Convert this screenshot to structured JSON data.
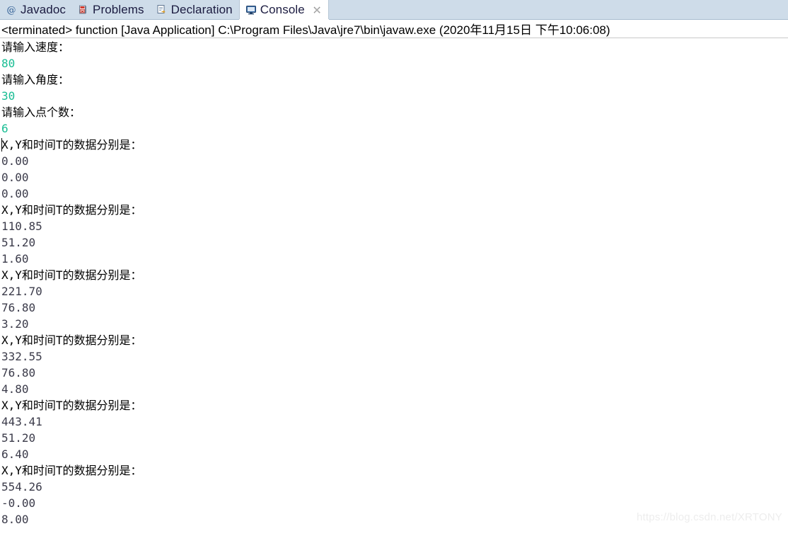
{
  "tabs": [
    {
      "id": "javadoc",
      "label": "Javadoc",
      "icon": "javadoc-at-icon",
      "active": false,
      "closable": false
    },
    {
      "id": "problems",
      "label": "Problems",
      "icon": "problems-error-icon",
      "active": false,
      "closable": false
    },
    {
      "id": "declaration",
      "label": "Declaration",
      "icon": "declaration-doc-icon",
      "active": false,
      "closable": false
    },
    {
      "id": "console",
      "label": "Console",
      "icon": "console-monitor-icon",
      "active": true,
      "closable": true
    }
  ],
  "close_icon": "close-x-icon",
  "process": {
    "status": "<terminated>",
    "launch_name": "function",
    "launch_type": "[Java Application]",
    "executable": "C:\\Program Files\\Java\\jre7\\bin\\javaw.exe",
    "timestamp": "(2020年11月15日 下午10:06:08)",
    "full_line": "<terminated> function [Java Application] C:\\Program Files\\Java\\jre7\\bin\\javaw.exe (2020年11月15日 下午10:06:08)"
  },
  "colors": {
    "tab_bar_background": "#cedce9",
    "active_tab_background": "#ffffff",
    "console_background": "#ffffff",
    "prompt_text": "#000000",
    "input_text": "#18bd93",
    "value_text": "#3b3b4a",
    "watermark_text": "#ededed"
  },
  "console": {
    "lines": [
      {
        "kind": "prompt",
        "text": "请输入速度："
      },
      {
        "kind": "input",
        "text": "80"
      },
      {
        "kind": "prompt",
        "text": "请输入角度："
      },
      {
        "kind": "input",
        "text": "30"
      },
      {
        "kind": "prompt",
        "text": "请输入点个数："
      },
      {
        "kind": "input",
        "text": "6"
      },
      {
        "kind": "header",
        "text": "X,Y和时间T的数据分别是：",
        "caret": true
      },
      {
        "kind": "value",
        "text": "0.00"
      },
      {
        "kind": "value",
        "text": "0.00"
      },
      {
        "kind": "value",
        "text": "0.00"
      },
      {
        "kind": "header",
        "text": "X,Y和时间T的数据分别是："
      },
      {
        "kind": "value",
        "text": "110.85"
      },
      {
        "kind": "value",
        "text": "51.20"
      },
      {
        "kind": "value",
        "text": "1.60"
      },
      {
        "kind": "header",
        "text": "X,Y和时间T的数据分别是："
      },
      {
        "kind": "value",
        "text": "221.70"
      },
      {
        "kind": "value",
        "text": "76.80"
      },
      {
        "kind": "value",
        "text": "3.20"
      },
      {
        "kind": "header",
        "text": "X,Y和时间T的数据分别是："
      },
      {
        "kind": "value",
        "text": "332.55"
      },
      {
        "kind": "value",
        "text": "76.80"
      },
      {
        "kind": "value",
        "text": "4.80"
      },
      {
        "kind": "header",
        "text": "X,Y和时间T的数据分别是："
      },
      {
        "kind": "value",
        "text": "443.41"
      },
      {
        "kind": "value",
        "text": "51.20"
      },
      {
        "kind": "value",
        "text": "6.40"
      },
      {
        "kind": "header",
        "text": "X,Y和时间T的数据分别是："
      },
      {
        "kind": "value",
        "text": "554.26"
      },
      {
        "kind": "value",
        "text": "-0.00"
      },
      {
        "kind": "value",
        "text": "8.00"
      }
    ]
  },
  "watermark": {
    "text": "https://blog.csdn.net/XRTONY"
  }
}
